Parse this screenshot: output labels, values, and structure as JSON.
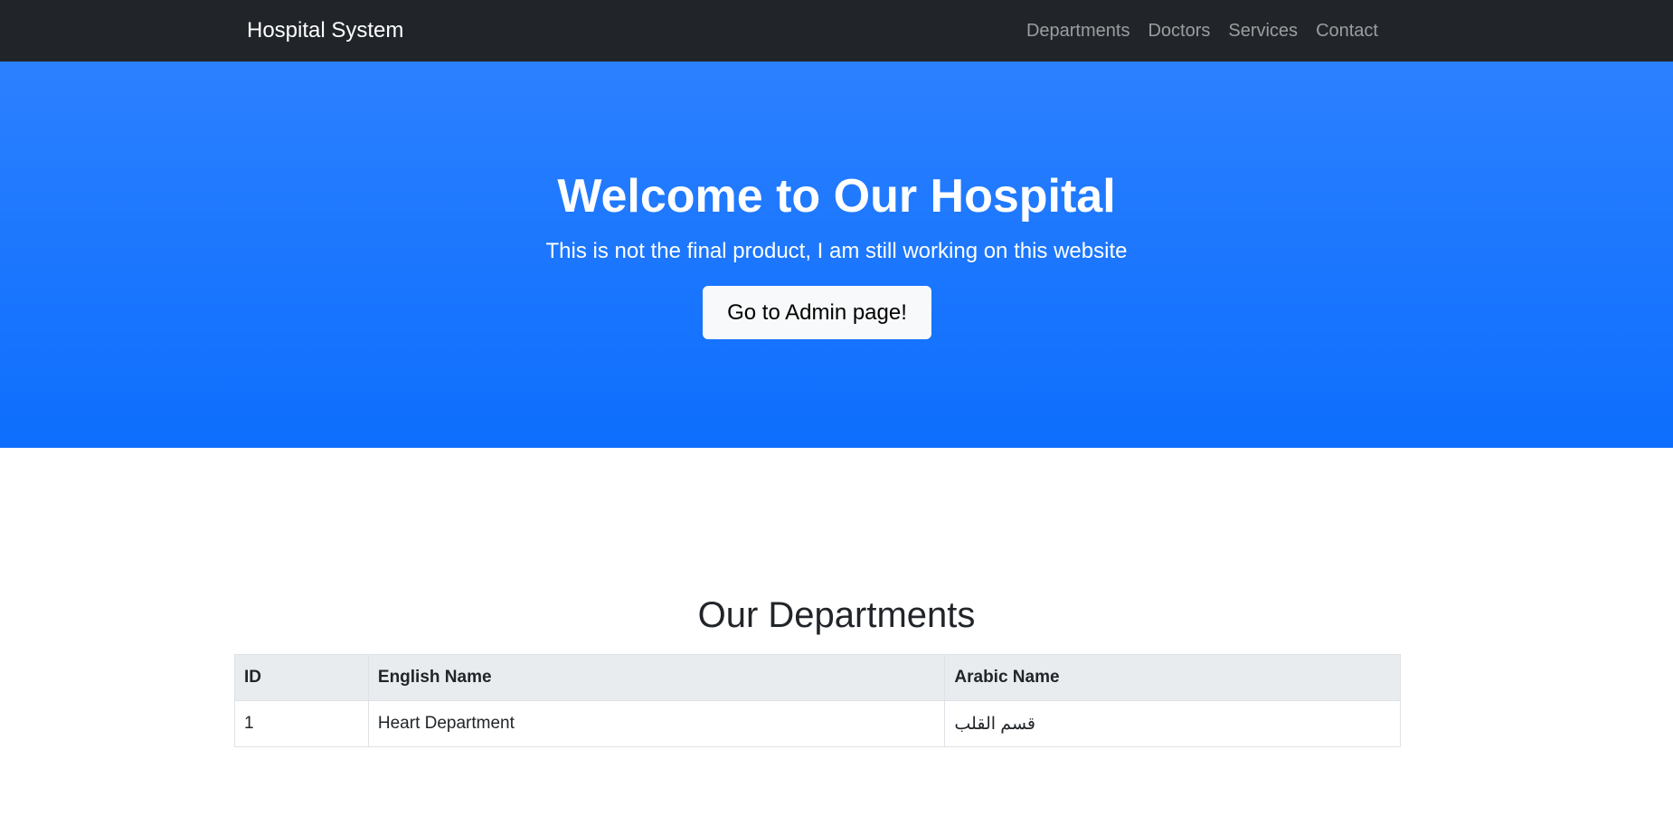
{
  "navbar": {
    "brand": "Hospital System",
    "links": [
      {
        "label": "Departments"
      },
      {
        "label": "Doctors"
      },
      {
        "label": "Services"
      },
      {
        "label": "Contact"
      }
    ]
  },
  "hero": {
    "title": "Welcome to Our Hospital",
    "subtitle": "This is not the final product, I am still working on this website",
    "button_label": "Go to Admin page!"
  },
  "departments": {
    "title": "Our Departments",
    "headers": [
      "ID",
      "English Name",
      "Arabic Name"
    ],
    "rows": [
      {
        "id": "1",
        "english_name": "Heart Department",
        "arabic_name": "قسم القلب"
      }
    ]
  },
  "colors": {
    "navbar_bg": "#212529",
    "hero_bg": "#0d6efd",
    "button_bg": "#f8f9fa",
    "table_header_bg": "#e9ecef"
  }
}
